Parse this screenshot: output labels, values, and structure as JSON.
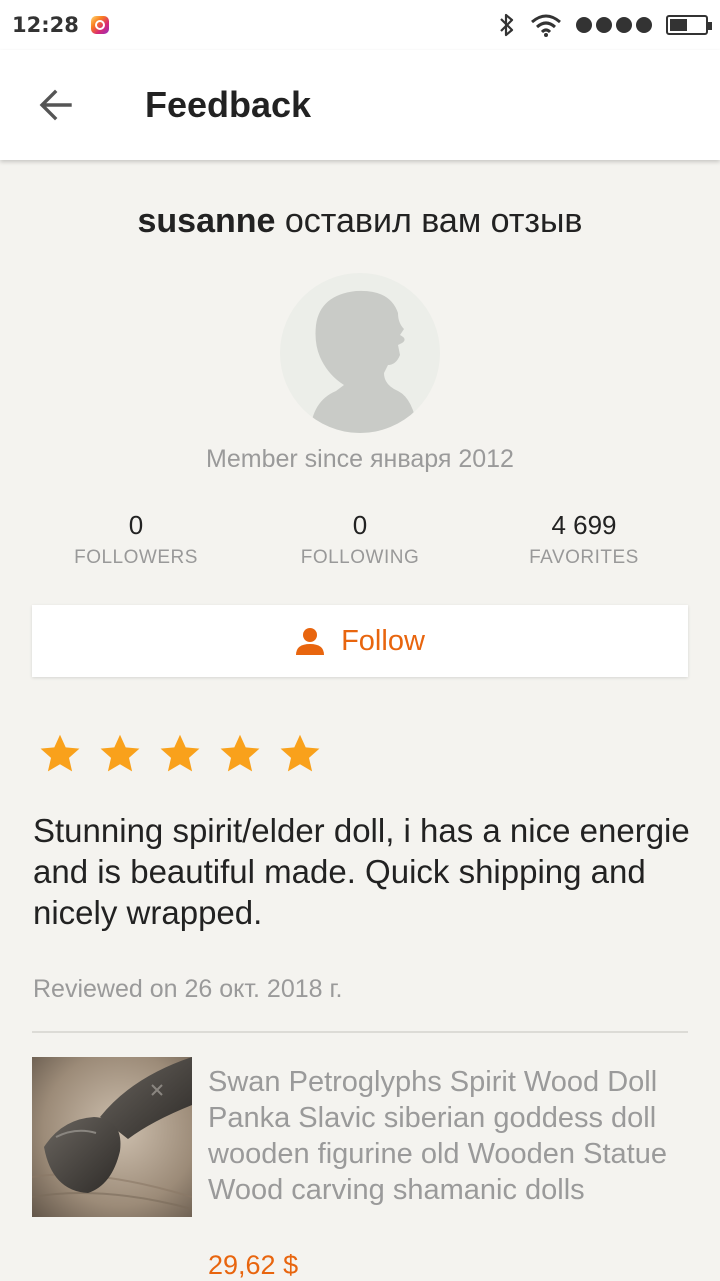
{
  "status_bar": {
    "time": "12:28",
    "icons": [
      "instagram-icon",
      "bluetooth-icon",
      "wifi-icon",
      "signal-icon",
      "battery-icon"
    ]
  },
  "app_bar": {
    "title": "Feedback",
    "back_icon": "arrow-left-icon"
  },
  "profile": {
    "username": "susanne",
    "headline_suffix": " оставил вам отзыв",
    "member_since": "Member since января 2012",
    "stats": [
      {
        "value": "0",
        "label": "FOLLOWERS"
      },
      {
        "value": "0",
        "label": "FOLLOWING"
      },
      {
        "value": "4 699",
        "label": "FAVORITES"
      }
    ],
    "follow_label": "Follow"
  },
  "review": {
    "rating": 5,
    "max_rating": 5,
    "text": "Stunning spirit/elder doll, i has a nice energie and is beautiful made. Quick shipping and nicely wrapped.",
    "date": "Reviewed on 26 окт. 2018 г."
  },
  "listing": {
    "title": "Swan Petroglyphs Spirit Wood Doll Panka Slavic siberian goddess doll wooden figurine old Wooden Statue Wood carving shamanic dolls",
    "price": "29,62 $"
  },
  "colors": {
    "accent": "#e8650e",
    "star": "#f9a11b",
    "background": "#f4f3ef",
    "muted_text": "#9a9a9a"
  }
}
